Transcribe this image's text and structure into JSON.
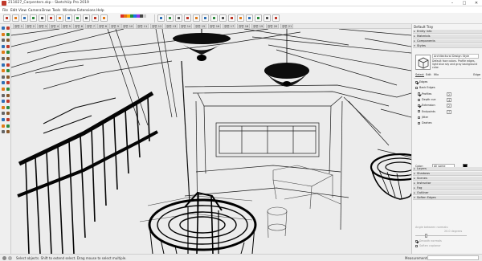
{
  "window": {
    "title": "211027_Carpenters.skp - SketchUp Pro 2019",
    "controls": [
      "–",
      "□",
      "✕"
    ]
  },
  "menu": [
    "File",
    "Edit",
    "View",
    "Camera",
    "Draw",
    "Tools",
    "Window",
    "Extensions",
    "Help"
  ],
  "scene_tabs": [
    "장면 1",
    "장면 2",
    "장면 3",
    "장면 4",
    "장면 5",
    "장면 6",
    "장면 7",
    "장면 8",
    "장면 9",
    "장면 10",
    "장면 11",
    "장면 12",
    "장면 13",
    "장면 14",
    "장면 15",
    "장면 16",
    "장면 17",
    "장면 18",
    "장면 19",
    "장면 20",
    "장면 21"
  ],
  "tray": {
    "title": "Default Tray",
    "panels_top": [
      "Entity Info",
      "Materials",
      "Components"
    ],
    "styles_panel": "Styles",
    "style_name": "Architectural Design Style",
    "style_description": "Default face colors. Profile edges, light blue sky and gray background color.",
    "tabs": [
      "Select",
      "Edit",
      "Mix"
    ],
    "edge_label": "Edge",
    "edge_settings": [
      {
        "label": "Edges",
        "checked": true,
        "value": ""
      },
      {
        "label": "Back Edges",
        "checked": false,
        "value": ""
      },
      {
        "label": "Profiles",
        "checked": true,
        "value": "2"
      },
      {
        "label": "Depth cue",
        "checked": false,
        "value": "4"
      },
      {
        "label": "Extension",
        "checked": true,
        "value": "2"
      },
      {
        "label": "Endpoints",
        "checked": false,
        "value": "7"
      },
      {
        "label": "Jitter",
        "checked": false,
        "value": ""
      },
      {
        "label": "Dashes",
        "checked": false,
        "value": ""
      }
    ],
    "color_label": "Color:",
    "color_value": "All same",
    "color_swatch": "#000000",
    "panels_bottom": [
      "Layers",
      "Shadows",
      "Scenes",
      "Instructor",
      "Fog",
      "Outliner",
      "Soften Edges"
    ],
    "soften": {
      "normals_label": "Angle between normals:",
      "normals_value": "20.0 degrees",
      "options": [
        "Smooth normals",
        "Soften coplanar"
      ],
      "slider_fraction": 0.2
    }
  },
  "status": {
    "text": "Select objects. Shift to extend select. Drag mouse to select multiple.",
    "measurements_label": "Measurements",
    "measurements_value": ""
  },
  "colors": {
    "accent": "#1e5fae",
    "tool_red": "#c0392b",
    "tool_green": "#2e8b3d",
    "tool_orange": "#e07b1a",
    "tool_blue": "#2f6fb5"
  },
  "icons": {
    "toolbar": [
      "select-icon",
      "paint-bucket-icon",
      "eraser-icon",
      "tape-measure-icon",
      "rectangle-icon",
      "line-icon",
      "circle-icon",
      "arc-icon",
      "push-pull-icon",
      "offset-icon",
      "move-icon",
      "rotate-icon",
      "scale-icon",
      "follow-me-icon",
      "text-icon",
      "orbit-icon",
      "pan-icon",
      "zoom-icon",
      "zoom-extents-icon",
      "walk-icon",
      "look-around-icon",
      "position-camera-icon",
      "section-plane-icon",
      "warehouse-icon",
      "extension-warehouse-icon",
      "layout-icon"
    ],
    "left_tools": [
      "select-icon",
      "eraser-icon",
      "paint-bucket-icon",
      "line-icon",
      "freehand-icon",
      "rectangle-icon",
      "rotated-rectangle-icon",
      "circle-icon",
      "polygon-icon",
      "arc-icon",
      "pie-icon",
      "move-icon",
      "push-pull-icon",
      "rotate-icon",
      "follow-me-icon",
      "scale-icon",
      "offset-icon",
      "tape-measure-icon",
      "dimension-icon",
      "protractor-icon",
      "text-icon",
      "axes-icon",
      "3d-text-icon",
      "orbit-icon",
      "pan-icon",
      "zoom-icon",
      "zoom-window-icon",
      "zoom-extents-icon",
      "previous-view-icon",
      "position-camera-icon",
      "walk-icon",
      "look-around-icon",
      "section-plane-icon",
      "sandbox-icon",
      "warehouse-icon",
      "extension-icon"
    ]
  }
}
